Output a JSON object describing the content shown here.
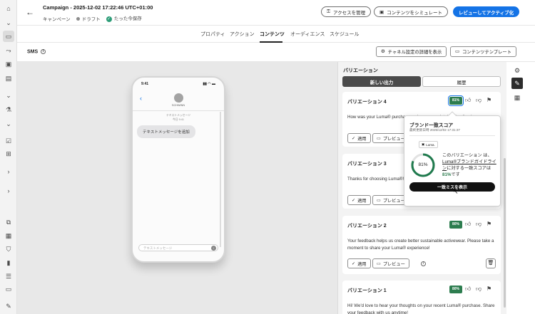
{
  "header": {
    "title": "Campaign - 2025-12-02 17:22:46 UTC+01:00",
    "type": "キャンペーン",
    "status": "ドラフト",
    "saved": "たった今保存",
    "manage_access": "アクセスを管理",
    "simulate": "コンテンツをシミュレート",
    "review_activate": "レビューしてアクティブ化"
  },
  "tabs": [
    "プロパティ",
    "アクション",
    "コンテンツ",
    "オーディエンス",
    "スケジュール"
  ],
  "active_tab": "コンテンツ",
  "subbar": {
    "channel": "SMS",
    "channel_settings": "チャネル設定の詳細を表示",
    "content_template": "コンテンツテンプレート"
  },
  "phone": {
    "time": "9:41",
    "sender": "SCHWINN",
    "meta_line1": "テキストメッセージ",
    "meta_line2": "今日 9:41",
    "bubble": "テキストメッセージを追加",
    "input_placeholder": "テキストメッセージ"
  },
  "panel": {
    "title": "バリエーション",
    "seg_new": "新しい出力",
    "seg_history": "履歴",
    "apply": "適用",
    "preview": "プレビュー",
    "variations": [
      {
        "title": "バリエーション 4",
        "score": "81%",
        "body": "How was your Luma® purchase... share more detailed feedback..."
      },
      {
        "title": "バリエーション 3",
        "score": "",
        "body": "Thanks for choosing Luma®! H... exclusive rewards. Share your..."
      },
      {
        "title": "バリエーション 2",
        "score": "80%",
        "body": "Your feedback helps us create better sustainable activewear. Please take a moment to share your Luma® experience!"
      },
      {
        "title": "バリエーション 1",
        "score": "80%",
        "body": "Hi! We'd love to hear your thoughts on your recent Luma® purchase. Share your feedback with us anytime!"
      }
    ]
  },
  "popover": {
    "title": "ブランド一致スコア",
    "date": "最終更新日時 2025/12/02 17:31:37",
    "brand": "Luma.",
    "score": "81%",
    "score_value": 81,
    "desc_pre": "このバリエーション は、",
    "desc_link": "Luma®ブランドガイドライン",
    "desc_mid": "に対する一致スコアは",
    "desc_pct": "81%",
    "desc_post": "です",
    "button": "一致ミスを表示"
  },
  "colors": {
    "accent": "#1473e6",
    "score_green": "#2d7d4f",
    "ring_green": "#1f7a4d"
  }
}
